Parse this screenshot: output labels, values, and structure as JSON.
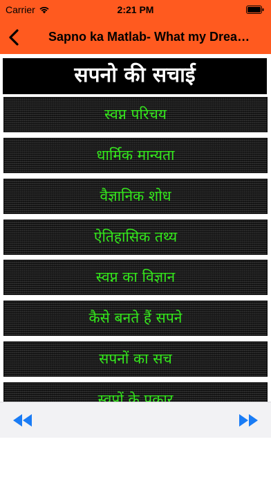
{
  "status_bar": {
    "carrier": "Carrier",
    "time": "2:21 PM",
    "wifi_icon": "wifi-icon",
    "battery_icon": "battery-icon"
  },
  "nav": {
    "title": "Sapno ka Matlab- What my Dreams Mean",
    "back_icon": "chevron-left-icon"
  },
  "heading": "सपनो की सचाई",
  "menu": [
    {
      "label": "स्वप्न परिचय"
    },
    {
      "label": "धार्मिक मान्यता"
    },
    {
      "label": "वैज्ञानिक शोध"
    },
    {
      "label": "ऐतिहासिक तथ्य"
    },
    {
      "label": "स्वप्न का विज्ञान"
    },
    {
      "label": "कैसे बनते हैं सपने"
    },
    {
      "label": "सपनों का सच"
    },
    {
      "label": "स्वप्नों के प्रकार"
    }
  ],
  "toolbar": {
    "rewind_icon": "rewind-icon",
    "forward_icon": "fast-forward-icon"
  },
  "colors": {
    "bar": "#ff5a1f",
    "menu_text": "#35e81d",
    "toolbar_icon": "#1a7cf5",
    "heading_bg": "#000000"
  }
}
